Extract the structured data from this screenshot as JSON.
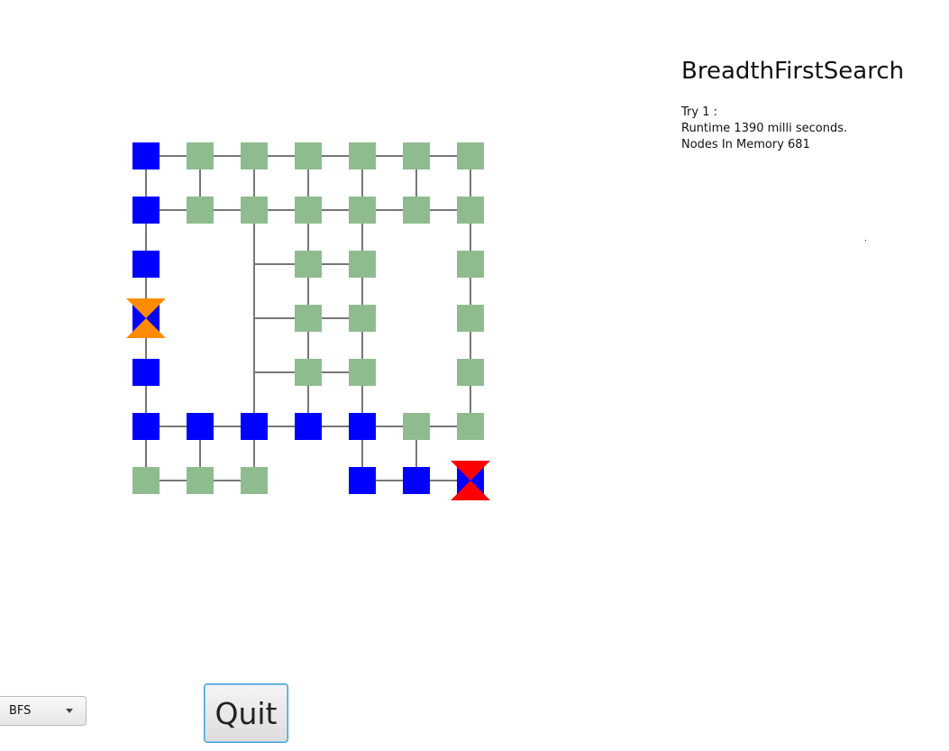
{
  "info": {
    "algorithm_name": "BreadthFirstSearch",
    "try_label": "Try 1 :",
    "runtime_text": "Runtime 1390 milli seconds.",
    "nodes_text": "Nodes In Memory 681"
  },
  "controls": {
    "algorithm_select_value": "BFS",
    "quit_label": "Quit"
  },
  "maze": {
    "rows": 7,
    "cols": 7,
    "colors": {
      "unvisited": "#8fbc8f",
      "path": "#0000ff",
      "edge": "#777777",
      "start_marker": "#ff8c00",
      "goal_marker": "#ff0000"
    },
    "path_cells": [
      [
        0,
        0
      ],
      [
        1,
        0
      ],
      [
        2,
        0
      ],
      [
        3,
        0
      ],
      [
        4,
        0
      ],
      [
        5,
        0
      ],
      [
        5,
        1
      ],
      [
        5,
        2
      ],
      [
        5,
        3
      ],
      [
        5,
        4
      ],
      [
        6,
        4
      ],
      [
        6,
        5
      ],
      [
        6,
        6
      ]
    ],
    "missing_cells": [
      [
        2,
        1
      ],
      [
        2,
        2
      ],
      [
        2,
        5
      ],
      [
        3,
        1
      ],
      [
        3,
        2
      ],
      [
        3,
        5
      ],
      [
        4,
        1
      ],
      [
        4,
        2
      ],
      [
        4,
        5
      ],
      [
        6,
        3
      ]
    ],
    "start_cell": [
      3,
      0
    ],
    "goal_cell": [
      6,
      6
    ],
    "horizontal_edges": [
      [
        0,
        0
      ],
      [
        0,
        1
      ],
      [
        0,
        2
      ],
      [
        0,
        3
      ],
      [
        0,
        4
      ],
      [
        0,
        5
      ],
      [
        1,
        0
      ],
      [
        1,
        1
      ],
      [
        1,
        2
      ],
      [
        1,
        3
      ],
      [
        1,
        4
      ],
      [
        1,
        5
      ],
      [
        2,
        2
      ],
      [
        2,
        3
      ],
      [
        3,
        2
      ],
      [
        3,
        3
      ],
      [
        4,
        2
      ],
      [
        4,
        3
      ],
      [
        5,
        0
      ],
      [
        5,
        1
      ],
      [
        5,
        2
      ],
      [
        5,
        3
      ],
      [
        5,
        4
      ],
      [
        5,
        5
      ],
      [
        6,
        0
      ],
      [
        6,
        1
      ],
      [
        6,
        4
      ],
      [
        6,
        5
      ]
    ],
    "vertical_edges": [
      [
        0,
        0
      ],
      [
        0,
        1
      ],
      [
        0,
        2
      ],
      [
        0,
        3
      ],
      [
        0,
        4
      ],
      [
        0,
        5
      ],
      [
        0,
        6
      ],
      [
        1,
        0
      ],
      [
        1,
        2
      ],
      [
        1,
        3
      ],
      [
        1,
        4
      ],
      [
        1,
        6
      ],
      [
        2,
        0
      ],
      [
        2,
        2
      ],
      [
        2,
        3
      ],
      [
        2,
        4
      ],
      [
        2,
        6
      ],
      [
        3,
        0
      ],
      [
        3,
        2
      ],
      [
        3,
        3
      ],
      [
        3,
        4
      ],
      [
        3,
        6
      ],
      [
        4,
        0
      ],
      [
        4,
        2
      ],
      [
        4,
        3
      ],
      [
        4,
        4
      ],
      [
        4,
        6
      ],
      [
        5,
        0
      ],
      [
        5,
        1
      ],
      [
        5,
        2
      ],
      [
        5,
        4
      ],
      [
        5,
        5
      ]
    ]
  }
}
